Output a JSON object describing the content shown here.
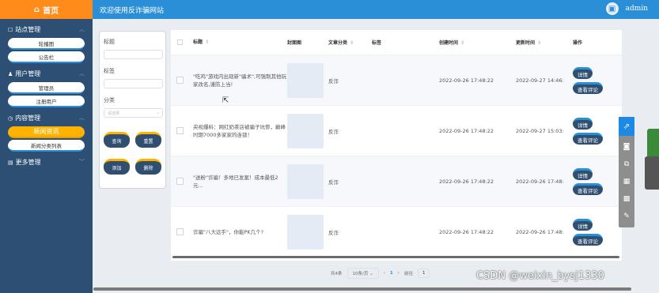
{
  "topbar": {
    "home_label": "首页",
    "welcome": "欢迎使用反诈骗网站",
    "admin_name": "admin"
  },
  "sidebar": {
    "groups": [
      {
        "label": "站点管理",
        "items": [
          {
            "label": "轮播图"
          },
          {
            "label": "公告栏"
          }
        ]
      },
      {
        "label": "用户管理",
        "items": [
          {
            "label": "管理员"
          },
          {
            "label": "注册用户"
          }
        ]
      },
      {
        "label": "内容管理",
        "items": [
          {
            "label": "新闻资讯"
          },
          {
            "label": "新闻分类列表"
          }
        ]
      },
      {
        "label": "更多管理",
        "items": []
      }
    ]
  },
  "search": {
    "title_label": "标题",
    "tag_label": "标签",
    "category_label": "分类",
    "category_placeholder": "请选择",
    "query_btn": "查询",
    "reset_btn": "重置",
    "add_btn": "添加",
    "delete_btn": "删除"
  },
  "table": {
    "headers": {
      "title": "标题",
      "cover": "封面图",
      "category": "文章分类",
      "tags": "标签",
      "created": "创建时间",
      "updated": "更新时间",
      "ops": "操作"
    },
    "detail_btn": "详情",
    "comment_btn": "查看评论",
    "rows": [
      {
        "title": "\"吃鸡\"游戏内出现新\"骗术\",可强制其他玩家改名,谨防上当!",
        "category": "反诈",
        "created": "2022-09-26 17:48:22",
        "updated": "2022-09-27 14:46:"
      },
      {
        "title": "央视爆料：网红奶茶店被骗子坑惨，巅峰时期7000多家家的连锁！",
        "category": "反诈",
        "created": "2022-09-26 17:48:22",
        "updated": "2022-09-27 15:03:"
      },
      {
        "title": "\"送粉\"诈骗！多地已发案！成本最低2元...",
        "category": "反诈",
        "created": "2022-09-26 17:48:22",
        "updated": "2022-09-26 17:48:"
      },
      {
        "title": "诈骗\"八大远手\"，你能PK几个?",
        "category": "反诈",
        "created": "2022-09-26 17:48:22",
        "updated": "2022-09-26 17:48:"
      }
    ]
  },
  "pager": {
    "total": "共4条",
    "page_size": "10条/页",
    "current_page": "1",
    "goto_label": "前往",
    "goto_value": "1"
  },
  "watermark": "CSDN @weixin_bysj1330",
  "colors": {
    "topbar": "#2a8fd6",
    "home": "#ff8c1a",
    "sidebar": "#2c4f73",
    "active": "#ffb300",
    "button": "#2f4e70"
  }
}
